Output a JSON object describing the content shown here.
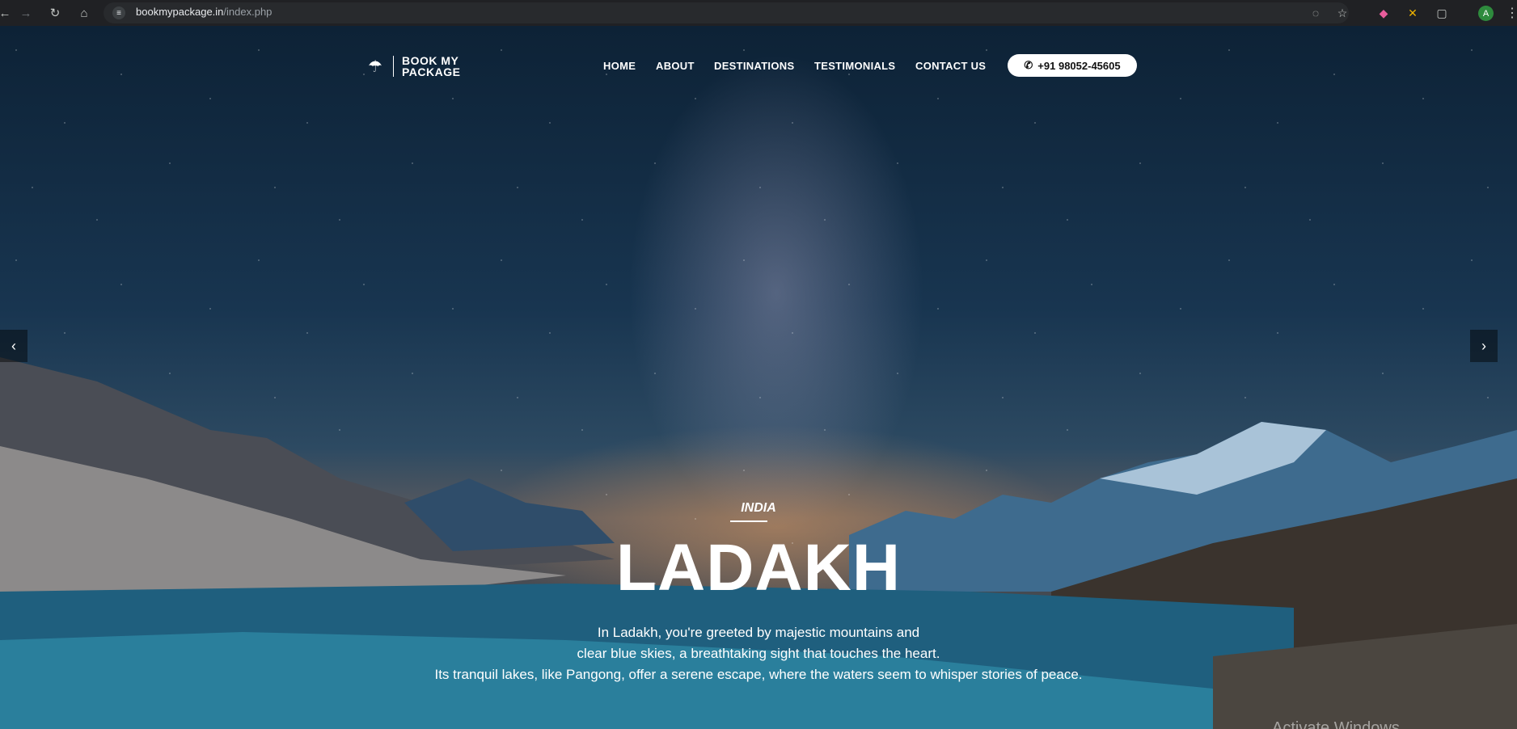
{
  "browser": {
    "url_domain": "bookmypackage.in",
    "url_path": "/index.php",
    "profile_initial": "A"
  },
  "site": {
    "logo_text_line1": "BOOK MY",
    "logo_text_line2": "PACKAGE",
    "nav": [
      "HOME",
      "ABOUT",
      "DESTINATIONS",
      "TESTIMONIALS",
      "CONTACT US"
    ],
    "phone": "+91 98052-45605"
  },
  "hero": {
    "country": "INDIA",
    "title": "LADAKH",
    "description_lines": [
      "In Ladakh, you're greeted by majestic mountains and",
      "clear blue skies, a breathtaking sight that touches the heart.",
      "Its tranquil lakes, like Pangong, offer a serene escape, where the waters seem to whisper stories of peace."
    ]
  },
  "overlay": {
    "watermark": "Activate Windows"
  },
  "icons": {
    "logo": "umbrella-icon",
    "phone": "phone-icon",
    "prev": "chevron-left-icon",
    "next": "chevron-right-icon"
  }
}
